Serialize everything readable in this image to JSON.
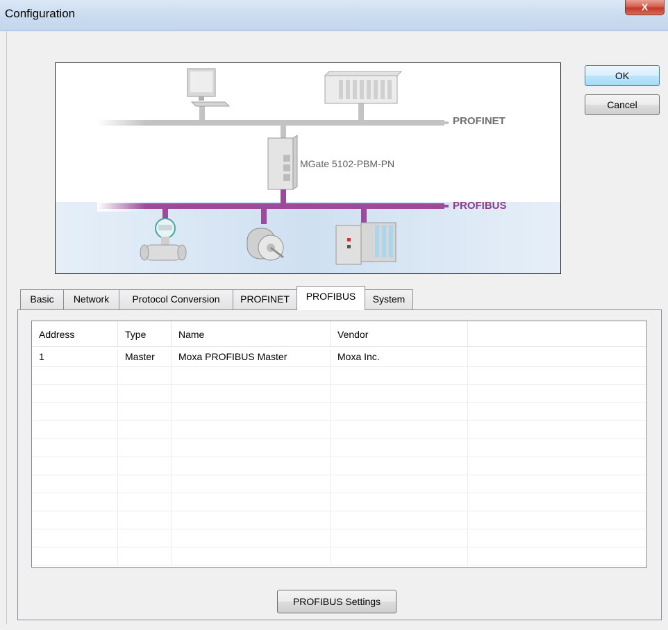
{
  "window": {
    "title": "Configuration",
    "close_label": "X"
  },
  "diagram": {
    "profinet_label": "PROFINET",
    "gateway_label": "MGate 5102-PBM-PN",
    "profibus_label": "PROFIBUS",
    "colors": {
      "profinet_bus": "#c0c0c0",
      "profibus_bus": "#9c4a9c",
      "profibus_zone": "#d6e6f4"
    }
  },
  "buttons": {
    "ok": "OK",
    "cancel": "Cancel",
    "profibus_settings": "PROFIBUS Settings"
  },
  "tabs": [
    {
      "label": "Basic"
    },
    {
      "label": "Network"
    },
    {
      "label": "Protocol Conversion"
    },
    {
      "label": "PROFINET"
    },
    {
      "label": "PROFIBUS",
      "active": true
    },
    {
      "label": "System"
    }
  ],
  "table": {
    "columns": [
      "Address",
      "Type",
      "Name",
      "Vendor",
      ""
    ],
    "rows": [
      [
        "1",
        "Master",
        "Moxa PROFIBUS Master",
        "Moxa Inc.",
        ""
      ],
      [
        "",
        "",
        "",
        "",
        ""
      ],
      [
        "",
        "",
        "",
        "",
        ""
      ],
      [
        "",
        "",
        "",
        "",
        ""
      ],
      [
        "",
        "",
        "",
        "",
        ""
      ],
      [
        "",
        "",
        "",
        "",
        ""
      ],
      [
        "",
        "",
        "",
        "",
        ""
      ],
      [
        "",
        "",
        "",
        "",
        ""
      ],
      [
        "",
        "",
        "",
        "",
        ""
      ],
      [
        "",
        "",
        "",
        "",
        ""
      ],
      [
        "",
        "",
        "",
        "",
        ""
      ],
      [
        "",
        "",
        "",
        "",
        ""
      ]
    ]
  }
}
